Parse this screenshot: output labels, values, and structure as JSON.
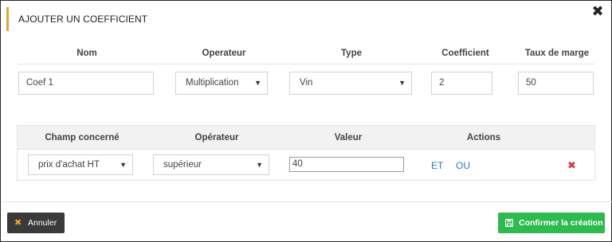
{
  "dialog": {
    "title": "AJOUTER UN COEFFICIENT",
    "close_icon": "close-icon",
    "accent_color": "#e2a72e"
  },
  "coef_table": {
    "headers": {
      "nom": "Nom",
      "operateur": "Operateur",
      "type": "Type",
      "coefficient": "Coefficient",
      "taux_marge": "Taux de marge"
    },
    "values": {
      "nom": "Coef 1",
      "operateur": "Multiplication",
      "type": "Vin",
      "coefficient": "2",
      "taux_marge": "50"
    }
  },
  "condition_table": {
    "headers": {
      "champ": "Champ concerné",
      "operateur": "Opérateur",
      "valeur": "Valeur",
      "actions": "Actions"
    },
    "row": {
      "champ": "prix d'achat HT",
      "operateur": "supérieur",
      "valeur": "40",
      "et_label": "ET",
      "ou_label": "OU",
      "remove_icon": "remove-icon"
    }
  },
  "footer": {
    "cancel_label": "Annuler",
    "confirm_label": "Confirmer la création",
    "cancel_color": "#3a3a3a",
    "confirm_color": "#2dba4e"
  }
}
